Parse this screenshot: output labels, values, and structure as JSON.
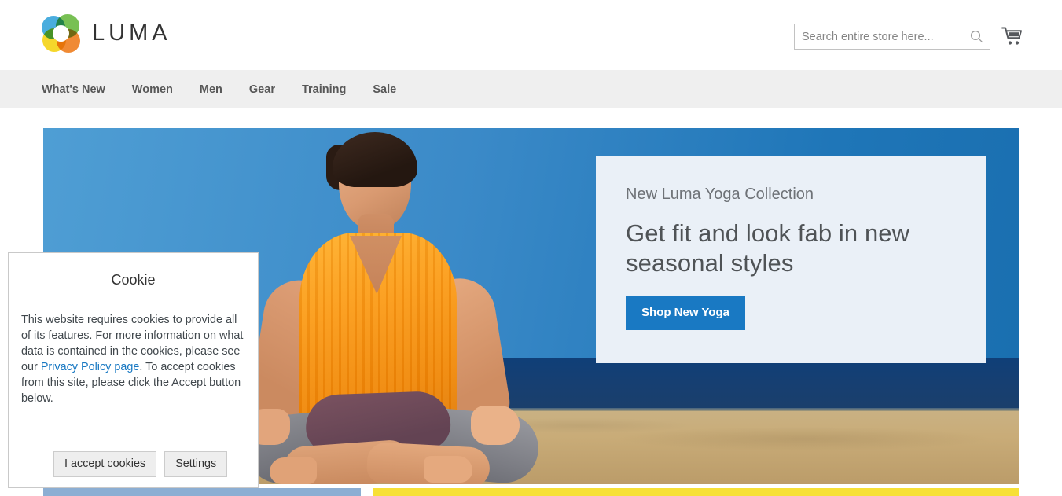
{
  "header": {
    "brand": "LUMA",
    "search": {
      "placeholder": "Search entire store here...",
      "value": "",
      "icon": "search-icon"
    },
    "cart": {
      "icon": "shopping-cart-icon",
      "label": ""
    }
  },
  "nav": {
    "items": [
      {
        "label": "What's New"
      },
      {
        "label": "Women"
      },
      {
        "label": "Men"
      },
      {
        "label": "Gear"
      },
      {
        "label": "Training"
      },
      {
        "label": "Sale"
      }
    ]
  },
  "banner": {
    "eyebrow": "New Luma Yoga Collection",
    "headline": "Get fit and look fab in new seasonal styles",
    "cta": "Shop New Yoga",
    "image_alt": "Woman meditating in lotus pose on a beach"
  },
  "cookie_dialog": {
    "title": "Cookie",
    "body_before_link": "This website requires cookies to provide all of its features. For more information on what data is contained in the cookies, please see our ",
    "link_text": "Privacy Policy page",
    "body_after_link": ". To accept cookies from this site, please click the Accept button below.",
    "accept_label": "I accept cookies",
    "settings_label": "Settings"
  },
  "colors": {
    "accent_blue": "#1979c3",
    "nav_bg": "#efefef",
    "promo_panel": "#eaf0f7",
    "sky": "#3b8ac8",
    "ocean": "#163f72",
    "sand": "#c4a876",
    "strip_blue": "#8caed3",
    "strip_yellow": "#f7e036",
    "logo_blue": "#3aa6dc",
    "logo_green": "#6cbb45",
    "logo_yellow": "#f5d419",
    "logo_orange": "#ef8022"
  }
}
